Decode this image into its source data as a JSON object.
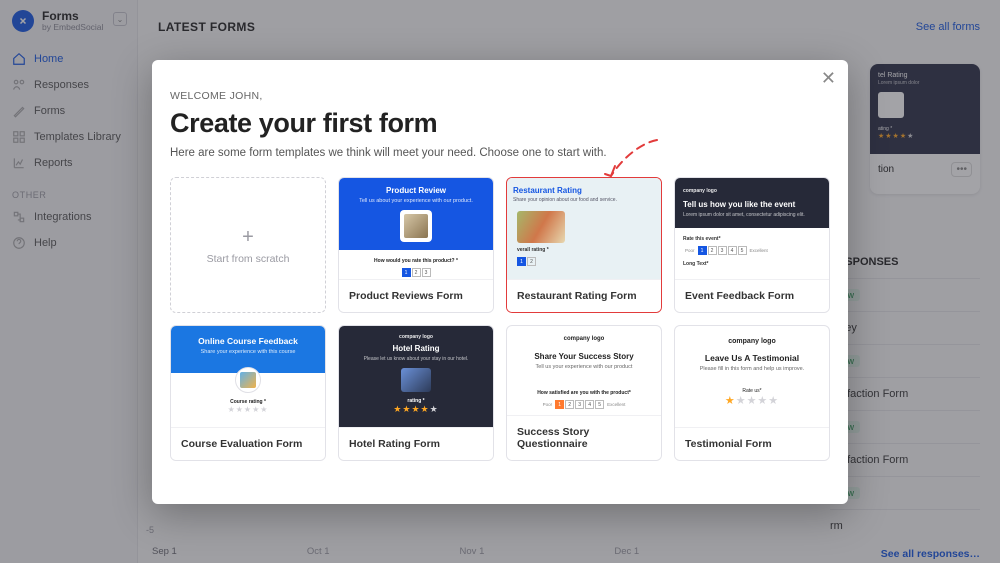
{
  "app": {
    "name": "Forms",
    "by": "by EmbedSocial"
  },
  "sidebar": {
    "main": [
      {
        "label": "Home"
      },
      {
        "label": "Responses"
      },
      {
        "label": "Forms"
      },
      {
        "label": "Templates Library"
      },
      {
        "label": "Reports"
      }
    ],
    "other_header": "OTHER",
    "other": [
      {
        "label": "Integrations"
      },
      {
        "label": "Help"
      }
    ]
  },
  "header": {
    "latest_forms": "LATEST FORMS",
    "see_all_forms": "See all forms"
  },
  "back_card": {
    "title": "tion",
    "dots": "•••"
  },
  "latest": {
    "title": "RESPONSES",
    "rows": [
      {
        "label": "urvey",
        "badge": "New"
      },
      {
        "label": "atisfaction Form",
        "badge": "New"
      },
      {
        "label": "atisfaction Form",
        "badge": "New"
      },
      {
        "label": "rm",
        "badge": "New"
      }
    ],
    "see_all": "See all responses…"
  },
  "axis": {
    "neg5": "-5",
    "labels": [
      "Sep 1",
      "Oct 1",
      "Nov 1",
      "Dec 1"
    ]
  },
  "modal": {
    "welcome": "WELCOME JOHN,",
    "title": "Create your first form",
    "sub": "Here are some form templates we think will meet your need. Choose one to start with.",
    "scratch": {
      "plus": "+",
      "label": "Start from scratch"
    },
    "templates": [
      {
        "name": "Product Reviews Form"
      },
      {
        "name": "Restaurant Rating Form"
      },
      {
        "name": "Event Feedback Form"
      },
      {
        "name": "Course Evaluation Form"
      },
      {
        "name": "Hotel Rating Form"
      },
      {
        "name": "Success Story Questionnaire"
      },
      {
        "name": "Testimonial Form"
      }
    ],
    "previews": {
      "product": {
        "title": "Product Review",
        "sub": "Tell us about your experience with our product.",
        "question": "How would you rate this product? *"
      },
      "restaurant": {
        "title": "Restaurant Rating",
        "sub": "Share your opinion about our food and service.",
        "question": "verall rating *"
      },
      "event": {
        "logo": "company logo",
        "title": "Tell us how you like the event",
        "sub": "Lorem ipsum dolor sit amet, consectetur adipiscing elit.",
        "q1": "Rate this event*",
        "q2": "Long Text*"
      },
      "course": {
        "title": "Online Course Feedback",
        "sub": "Share your experience with this course",
        "question": "Course rating *"
      },
      "hotel": {
        "logo": "company logo",
        "title": "Hotel Rating",
        "sub": "Please let us know about your stay in our hotel.",
        "question": "rating *"
      },
      "success": {
        "logo": "company logo",
        "title": "Share Your Success Story",
        "sub": "Tell us your experience with our product",
        "question": "How satisfied are you with the product*"
      },
      "testimonial": {
        "logo": "company logo",
        "title": "Leave Us A Testimonial",
        "sub": "Please fill in this form and help us improve.",
        "question": "Rate us*"
      },
      "scale_labels": {
        "poor": "Poor",
        "excellent": "Excellent"
      }
    }
  }
}
